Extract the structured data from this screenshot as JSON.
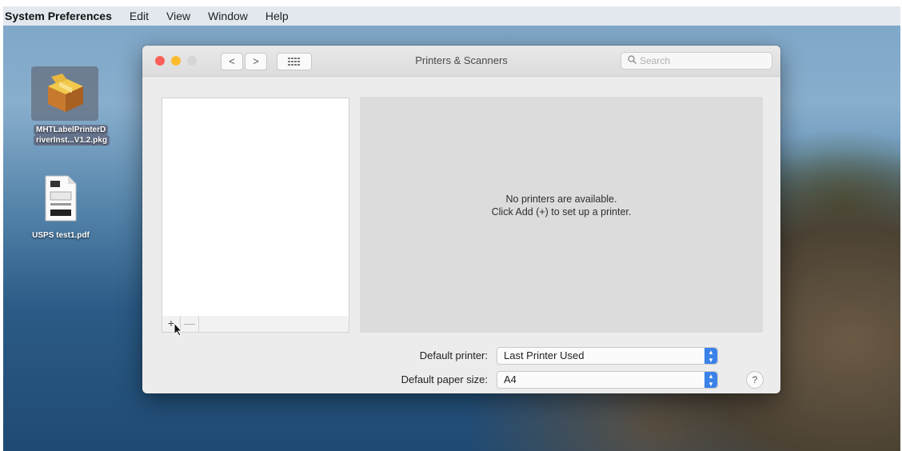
{
  "menubar": {
    "app_name": "System Preferences",
    "items": [
      "Edit",
      "View",
      "Window",
      "Help"
    ]
  },
  "desktop": {
    "icons": [
      {
        "label_line1": "MHTLabelPrinterD",
        "label_line2": "riverInst...V1.2.pkg",
        "icon": "package-icon"
      },
      {
        "label_line1": "USPS test1.pdf",
        "label_line2": "",
        "icon": "pdf-document-icon"
      }
    ]
  },
  "window": {
    "title": "Printers & Scanners",
    "search_placeholder": "Search",
    "nav_back": "<",
    "nav_forward": ">",
    "empty_message_line1": "No printers are available.",
    "empty_message_line2": "Click Add (+) to set up a printer.",
    "add_label": "+",
    "remove_label": "—",
    "default_printer_label": "Default printer:",
    "default_printer_value": "Last Printer Used",
    "default_paper_label": "Default paper size:",
    "default_paper_value": "A4",
    "help_label": "?"
  },
  "colors": {
    "close": "#fc5f57",
    "minimize": "#fdbc2e",
    "zoom_disabled": "#d5d5d5",
    "accent": "#3b82e8"
  }
}
